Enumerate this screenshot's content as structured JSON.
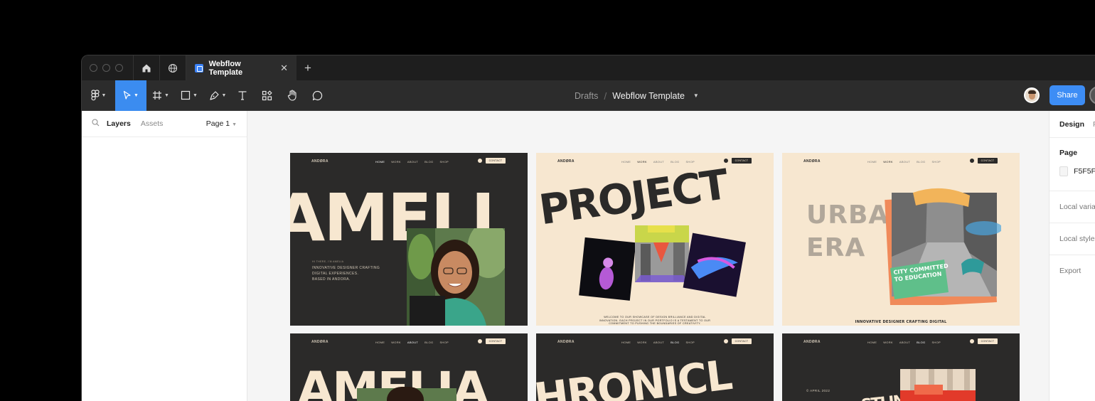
{
  "tabbar": {
    "tab_title": "Webflow Template",
    "close_glyph": "✕",
    "new_tab_glyph": "+"
  },
  "toolbar": {
    "breadcrumb_drafts": "Drafts",
    "breadcrumb_sep": "/",
    "file_name": "Webflow Template",
    "share_label": "Share",
    "tools": [
      "figma-menu-icon",
      "move-tool-icon",
      "frame-tool-icon",
      "rectangle-tool-icon",
      "pen-tool-icon",
      "text-tool-icon",
      "resources-icon",
      "hand-tool-icon",
      "comment-icon"
    ]
  },
  "left_panel": {
    "layers_tab": "Layers",
    "assets_tab": "Assets",
    "page_select": "Page 1"
  },
  "right_panel": {
    "design_tab": "Design",
    "prototype_tab": "P",
    "page_title": "Page",
    "page_color": "F5F5F",
    "local_variables": "Local varia",
    "local_styles": "Local style",
    "export": "Export"
  },
  "frames": {
    "f1": {
      "logo": "ANDØRA",
      "nav": [
        "HOME",
        "WORK",
        "ABOUT",
        "BLOG",
        "SHOP"
      ],
      "contact": "CONTACT",
      "headline": "AMELI",
      "intro_small": "HI THERE, I'M AMELIA",
      "intro": [
        "INNOVATIVE DESIGNER CRAFTING",
        "DIGITAL EXPERIENCES.",
        "BASED IN ANDORA."
      ]
    },
    "f2": {
      "logo": "ANDØRA",
      "nav": [
        "HOME",
        "WORK",
        "ABOUT",
        "BLOG",
        "SHOP"
      ],
      "contact": "CONTACT",
      "headline": "PROJECT",
      "body": [
        "WELCOME TO OUR SHOWCASE OF DESIGN BRILLIANCE AND DIGITAL",
        "INNOVATION. EACH PROJECT IN OUR PORTFOLIO IS A TESTAMENT TO OUR",
        "COMMITMENT TO PUSHING THE BOUNDARIES OF CREATIVITY."
      ]
    },
    "f3": {
      "logo": "ANDØRA",
      "nav": [
        "HOME",
        "WORK",
        "ABOUT",
        "BLOG",
        "SHOP"
      ],
      "contact": "CONTACT",
      "headline_1": "URBAN",
      "headline_2": "ERA",
      "sticker": "CITY COMMITTED TO EDUCATION",
      "tagline": "INNOVATIVE DESIGNER CRAFTING DIGITAL"
    },
    "f4": {
      "logo": "ANDØRA",
      "nav": [
        "HOME",
        "WORK",
        "ABOUT",
        "BLOG",
        "SHOP"
      ],
      "contact": "CONTACT",
      "headline": "AMELIA"
    },
    "f5": {
      "logo": "ANDØRA",
      "nav": [
        "HOME",
        "WORK",
        "ABOUT",
        "BLOG",
        "SHOP"
      ],
      "contact": "CONTACT",
      "headline": "HRONICL"
    },
    "f6": {
      "logo": "ANDØRA",
      "nav": [
        "HOME",
        "WORK",
        "ABOUT",
        "BLOG",
        "SHOP"
      ],
      "contact": "CONTACT",
      "date": "© APRIL 2022",
      "headline": "STLING"
    }
  },
  "colors": {
    "accent": "#3b8cf0",
    "dark": "#2b2a29",
    "cream": "#f7e7d0"
  }
}
